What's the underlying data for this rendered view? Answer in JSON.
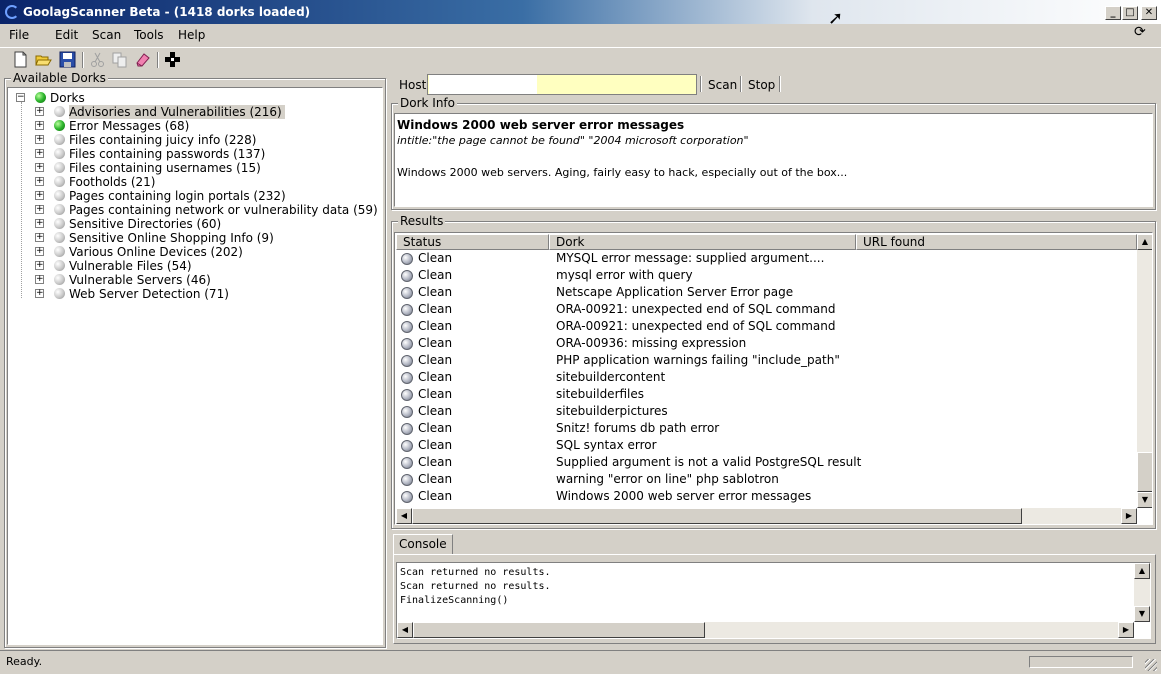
{
  "window": {
    "title": "GoolagScanner Beta  -  (1418 dorks loaded)"
  },
  "menu": [
    "File",
    "Edit",
    "Scan",
    "Tools",
    "Help"
  ],
  "toolbar": {
    "icons": [
      "new-icon",
      "open-icon",
      "save-icon",
      "cut-icon",
      "copy-icon",
      "eraser-icon",
      "crosshair-icon"
    ]
  },
  "dorks_panel": {
    "title": "Available Dorks",
    "root": "Dorks",
    "items": [
      {
        "label": "Advisories and Vulnerabilities  (216)",
        "status": "gray"
      },
      {
        "label": "Error Messages  (68)",
        "status": "green"
      },
      {
        "label": "Files containing juicy info  (228)",
        "status": "gray"
      },
      {
        "label": "Files containing passwords  (137)",
        "status": "gray"
      },
      {
        "label": "Files containing usernames  (15)",
        "status": "gray"
      },
      {
        "label": "Footholds  (21)",
        "status": "gray"
      },
      {
        "label": "Pages containing login portals  (232)",
        "status": "gray"
      },
      {
        "label": "Pages containing network or vulnerability data  (59)",
        "status": "gray"
      },
      {
        "label": "Sensitive Directories  (60)",
        "status": "gray"
      },
      {
        "label": "Sensitive Online Shopping Info  (9)",
        "status": "gray"
      },
      {
        "label": "Various Online Devices  (202)",
        "status": "gray"
      },
      {
        "label": "Vulnerable Files  (54)",
        "status": "gray"
      },
      {
        "label": "Vulnerable Servers  (46)",
        "status": "gray"
      },
      {
        "label": "Web Server Detection  (71)",
        "status": "gray"
      }
    ]
  },
  "host": {
    "label": "Host:",
    "value": "",
    "scan_label": "Scan",
    "stop_label": "Stop"
  },
  "dork_info": {
    "title": "Dork Info",
    "name": "Windows 2000 web server error messages",
    "query": "intitle:\"the page cannot be found\" \"2004 microsoft corporation\"",
    "description": "Windows 2000 web servers. Aging, fairly easy to hack, especially out of the box..."
  },
  "results": {
    "title": "Results",
    "columns": [
      "Status",
      "Dork",
      "URL found"
    ],
    "rows": [
      {
        "status": "Clean",
        "dork": "MYSQL error message: supplied argument....",
        "url": ""
      },
      {
        "status": "Clean",
        "dork": "mysql error with query",
        "url": ""
      },
      {
        "status": "Clean",
        "dork": "Netscape Application Server Error page",
        "url": ""
      },
      {
        "status": "Clean",
        "dork": "ORA-00921: unexpected end of SQL command",
        "url": ""
      },
      {
        "status": "Clean",
        "dork": "ORA-00921: unexpected end of SQL command",
        "url": ""
      },
      {
        "status": "Clean",
        "dork": "ORA-00936: missing expression",
        "url": ""
      },
      {
        "status": "Clean",
        "dork": "PHP application warnings failing \"include_path\"",
        "url": ""
      },
      {
        "status": "Clean",
        "dork": "sitebuildercontent",
        "url": ""
      },
      {
        "status": "Clean",
        "dork": "sitebuilderfiles",
        "url": ""
      },
      {
        "status": "Clean",
        "dork": "sitebuilderpictures",
        "url": ""
      },
      {
        "status": "Clean",
        "dork": "Snitz! forums db path error",
        "url": ""
      },
      {
        "status": "Clean",
        "dork": "SQL syntax error",
        "url": ""
      },
      {
        "status": "Clean",
        "dork": "Supplied argument is not a valid PostgreSQL result",
        "url": ""
      },
      {
        "status": "Clean",
        "dork": "warning \"error on line\" php sablotron",
        "url": ""
      },
      {
        "status": "Clean",
        "dork": "Windows 2000 web server error messages",
        "url": ""
      }
    ]
  },
  "console": {
    "tab_label": "Console",
    "lines": [
      "Scan returned no results.",
      "Scan returned no results.",
      "FinalizeScanning()"
    ]
  },
  "statusbar": {
    "text": "Ready."
  }
}
